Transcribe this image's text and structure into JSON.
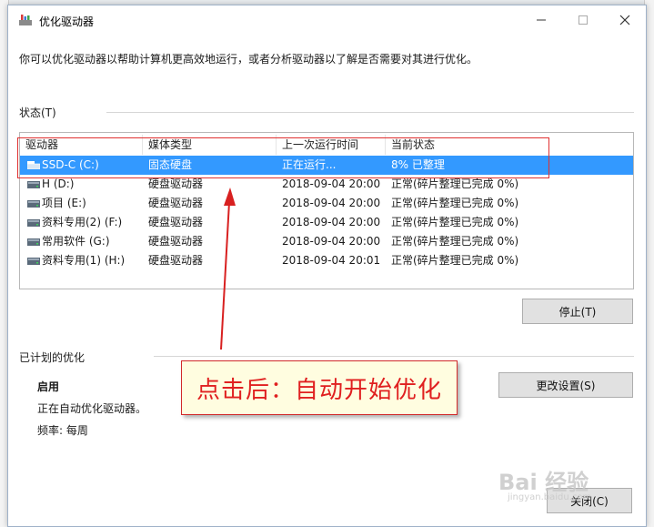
{
  "window": {
    "title": "优化驱动器",
    "description": "你可以优化驱动器以帮助计算机更高效地运行，或者分析驱动器以了解是否需要对其进行优化。"
  },
  "status_section": {
    "label": "状态(T)",
    "columns": [
      "驱动器",
      "媒体类型",
      "上一次运行时间",
      "当前状态"
    ],
    "rows": [
      {
        "drive": "SSD-C (C:)",
        "media": "固态硬盘",
        "last_run": "正在运行...",
        "status": "8% 已整理",
        "icon": "ssd-drive-icon",
        "selected": true
      },
      {
        "drive": "H (D:)",
        "media": "硬盘驱动器",
        "last_run": "2018-09-04 20:00",
        "status": "正常(碎片整理已完成 0%)",
        "icon": "hard-drive-icon",
        "selected": false
      },
      {
        "drive": "项目 (E:)",
        "media": "硬盘驱动器",
        "last_run": "2018-09-04 20:00",
        "status": "正常(碎片整理已完成 0%)",
        "icon": "hard-drive-icon",
        "selected": false
      },
      {
        "drive": "资料专用(2) (F:)",
        "media": "硬盘驱动器",
        "last_run": "2018-09-04 20:00",
        "status": "正常(碎片整理已完成 0%)",
        "icon": "hard-drive-icon",
        "selected": false
      },
      {
        "drive": "常用软件 (G:)",
        "media": "硬盘驱动器",
        "last_run": "2018-09-04 20:00",
        "status": "正常(碎片整理已完成 0%)",
        "icon": "hard-drive-icon",
        "selected": false
      },
      {
        "drive": "资料专用(1) (H:)",
        "media": "硬盘驱动器",
        "last_run": "2018-09-04 20:01",
        "status": "正常(碎片整理已完成 0%)",
        "icon": "hard-drive-icon",
        "selected": false
      }
    ],
    "stop_button": "停止(T)"
  },
  "scheduled": {
    "label": "已计划的优化",
    "state": "启用",
    "status_text": "正在自动优化驱动器。",
    "frequency": "频率: 每周",
    "change_button": "更改设置(S)"
  },
  "close_button": "关闭(C)",
  "annotation": {
    "text": "点击后：自动开始优化",
    "color": "#e02020"
  },
  "watermark": {
    "main": "Bai 经验",
    "sub": "jingyan.baidu.com"
  },
  "colors": {
    "selection": "#3399ff",
    "highlight_border": "#e03030"
  }
}
